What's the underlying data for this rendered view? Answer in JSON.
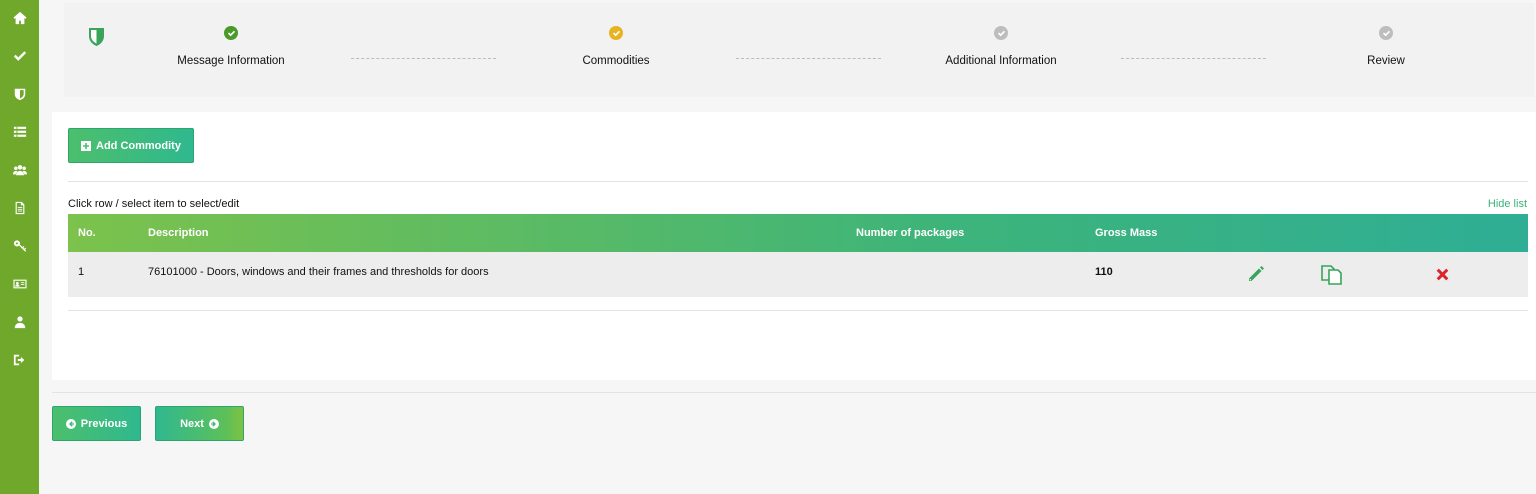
{
  "sidebar": {
    "items": [
      {
        "icon": "home-icon"
      },
      {
        "icon": "check-icon"
      },
      {
        "icon": "shield-icon"
      },
      {
        "icon": "list-icon"
      },
      {
        "icon": "users-icon"
      },
      {
        "icon": "document-icon"
      },
      {
        "icon": "key-icon"
      },
      {
        "icon": "id-card-icon"
      },
      {
        "icon": "user-icon"
      },
      {
        "icon": "sign-out-icon"
      }
    ]
  },
  "stepper": {
    "steps": [
      {
        "label": "Message Information",
        "status": "done",
        "color": "#4a9a2a"
      },
      {
        "label": "Commodities",
        "status": "current",
        "color": "#e8b321"
      },
      {
        "label": "Additional Information",
        "status": "pending",
        "color": "#bdbdbd"
      },
      {
        "label": "Review",
        "status": "pending",
        "color": "#bdbdbd"
      }
    ]
  },
  "toolbar": {
    "add_label": "Add Commodity"
  },
  "list": {
    "hint": "Click row / select item to select/edit",
    "hide_label": "Hide list",
    "columns": {
      "no": "No.",
      "description": "Description",
      "packages": "Number of packages",
      "gross_mass": "Gross Mass"
    },
    "rows": [
      {
        "no": "1",
        "description": "76101000 - Doors, windows and their frames and thresholds for doors",
        "packages": "",
        "gross_mass": "110"
      }
    ]
  },
  "nav": {
    "previous_label": "Previous",
    "next_label": "Next"
  },
  "colors": {
    "brand": "#6fa82a",
    "accent": "#3db47a",
    "danger": "#d9262b"
  }
}
